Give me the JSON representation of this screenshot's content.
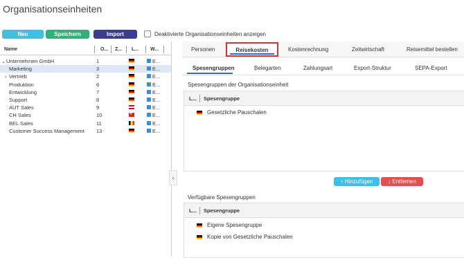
{
  "page_title": "Organisationseinheiten",
  "toolbar": {
    "new_label": "Neu",
    "save_label": "Speichern",
    "import_label": "Import",
    "show_deactivated_label": "Deaktivierte Organisationseinheiten anzeigen",
    "colors": {
      "new": "#3fc0e0",
      "save": "#2db37a",
      "import": "#3d3d8f"
    }
  },
  "tree": {
    "columns": [
      "Name",
      "O...",
      "Z...",
      "L...",
      "W..."
    ],
    "rows": [
      {
        "name": "Unternehmen GmbH",
        "num": "1",
        "flag": "de",
        "w": "E...",
        "indent": 0,
        "expander": "⌄"
      },
      {
        "name": "Marketing",
        "num": "3",
        "flag": "de",
        "w": "E...",
        "indent": 1,
        "expander": ""
      },
      {
        "name": "Vertrieb",
        "num": "2",
        "flag": "de",
        "w": "E...",
        "indent": 1,
        "expander": "›"
      },
      {
        "name": "Produktion",
        "num": "6",
        "flag": "de",
        "w": "E...",
        "indent": 1,
        "expander": ""
      },
      {
        "name": "Entwicklung",
        "num": "7",
        "flag": "de",
        "w": "E...",
        "indent": 1,
        "expander": ""
      },
      {
        "name": "Support",
        "num": "8",
        "flag": "de",
        "w": "E...",
        "indent": 1,
        "expander": ""
      },
      {
        "name": "AUT Sales",
        "num": "9",
        "flag": "at",
        "w": "E...",
        "indent": 1,
        "expander": ""
      },
      {
        "name": "CH Sales",
        "num": "10",
        "flag": "ch",
        "w": "E...",
        "indent": 1,
        "expander": ""
      },
      {
        "name": "BEL Sales",
        "num": "11",
        "flag": "be",
        "w": "E...",
        "indent": 1,
        "expander": ""
      },
      {
        "name": "Customer Success Management",
        "num": "13",
        "flag": "de",
        "w": "E...",
        "indent": 1,
        "expander": ""
      }
    ],
    "selected_row": "Marketing"
  },
  "main_tabs": [
    "Personen",
    "Reisekosten",
    "Kostenrechnung",
    "Zeitwirtschaft",
    "Reisemittel bestellen"
  ],
  "active_main_tab": "Reisekosten",
  "sub_tabs": [
    "Spesengruppen",
    "Belegarten",
    "Zahlungsart",
    "Export-Struktur",
    "SEPA-Export"
  ],
  "active_sub_tab": "Spesengruppen",
  "assigned": {
    "heading": "Spesengruppen der Organisationseinheit",
    "col_l": "L...",
    "col_name": "Spesengruppe",
    "rows": [
      {
        "flag": "de",
        "name": "Gesetzliche Pauschalen"
      }
    ]
  },
  "actions": {
    "add_label": "Hinzufügen",
    "remove_label": "Entfernen",
    "colors": {
      "add": "#3fc0e0",
      "remove": "#e05050"
    }
  },
  "available": {
    "heading": "Verfügbare Spesengruppen",
    "col_l": "L...",
    "col_name": "Spesengruppe",
    "rows": [
      {
        "flag": "de",
        "name": "Eigene Spesengruppe"
      },
      {
        "flag": "de",
        "name": "Kopie von Gesetzliche Pauschalen"
      }
    ]
  }
}
